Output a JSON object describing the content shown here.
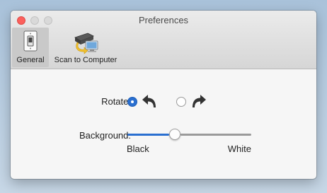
{
  "window": {
    "title": "Preferences"
  },
  "toolbar": {
    "items": [
      {
        "label": "General",
        "icon": "light-switch-icon",
        "selected": true
      },
      {
        "label": "Scan to Computer",
        "icon": "scanner-computer-icon",
        "selected": false
      }
    ]
  },
  "rotate": {
    "label": "Rotate:",
    "options": [
      {
        "icon": "rotate-left-arrow-icon",
        "selected": true
      },
      {
        "icon": "rotate-right-arrow-icon",
        "selected": false
      }
    ]
  },
  "background": {
    "label": "Background:",
    "slider_value": 0.38,
    "min_label": "Black",
    "max_label": "White"
  },
  "colors": {
    "accent": "#2a6fd0",
    "close_button": "#fc605c"
  }
}
